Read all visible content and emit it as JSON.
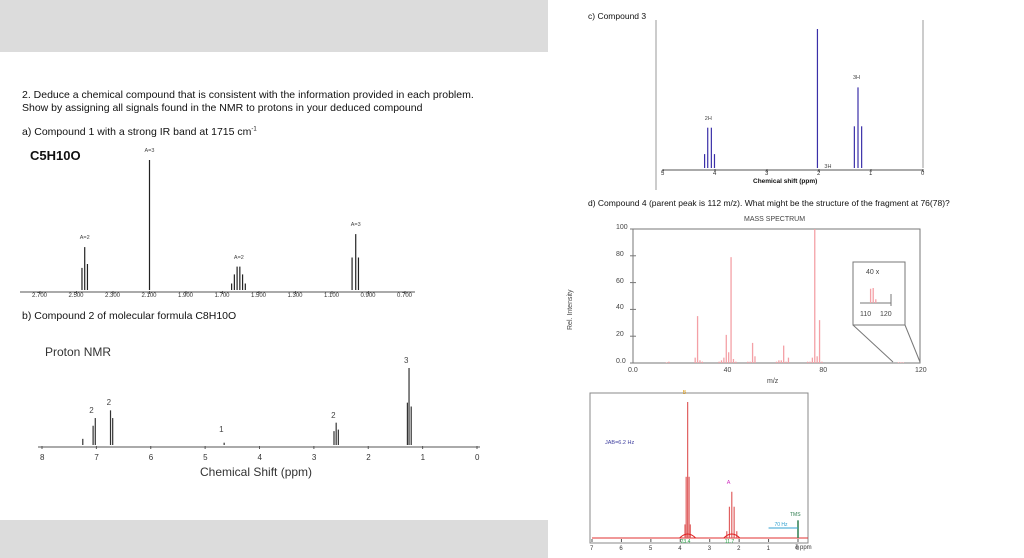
{
  "document": {
    "question": "2.  Deduce a chemical compound that is consistent with the information provided in each problem.",
    "question_line2": "Show by assigning all signals found in the NMR to protons in your deduced compound",
    "part_a": "a) Compound 1 with a strong IR band at 1715 cm",
    "part_a_sup": "-1",
    "part_a_formula": "C5H10O",
    "part_b": "b) Compound 2 of molecular formula C8H10O",
    "part_b_title": "Proton NMR",
    "part_c": "c)  Compound 3",
    "part_d": "d)  Compound 4 (parent peak is 112 m/z).  What might be the structure of the fragment at 76(78)?"
  },
  "chart_data": [
    {
      "id": "a",
      "type": "nmr",
      "xlim": [
        2.7,
        0.7
      ],
      "tick_labels": [
        "2.700",
        "2.500",
        "2.300",
        "2.100",
        "1.900",
        "1.700",
        "1.500",
        "1.300",
        "1.100",
        "0.900",
        "0.700"
      ],
      "peaks": [
        [
          2.47,
          0.17
        ],
        [
          2.455,
          0.33
        ],
        [
          2.44,
          0.2
        ],
        [
          2.1,
          1.0
        ],
        [
          1.65,
          0.05
        ],
        [
          1.635,
          0.12
        ],
        [
          1.62,
          0.18
        ],
        [
          1.605,
          0.18
        ],
        [
          1.59,
          0.12
        ],
        [
          1.575,
          0.05
        ],
        [
          0.99,
          0.25
        ],
        [
          0.97,
          0.43
        ],
        [
          0.955,
          0.25
        ]
      ],
      "annotations": [
        {
          "ppm": 2.455,
          "text": "A=2"
        },
        {
          "ppm": 2.1,
          "text": "A=3"
        },
        {
          "ppm": 1.61,
          "text": "A=2"
        },
        {
          "ppm": 0.97,
          "text": "A=3"
        }
      ],
      "color": "#222222"
    },
    {
      "id": "b",
      "type": "nmr",
      "xlim": [
        8,
        0
      ],
      "xlabel": "Chemical Shift (ppm)",
      "tick_labels": [
        "8",
        "7",
        "6",
        "5",
        "4",
        "3",
        "2",
        "1",
        "0"
      ],
      "peaks": [
        [
          7.25,
          0.08
        ],
        [
          7.06,
          0.25
        ],
        [
          7.02,
          0.35
        ],
        [
          6.74,
          0.45
        ],
        [
          6.7,
          0.35
        ],
        [
          4.65,
          0.03
        ],
        [
          2.63,
          0.18
        ],
        [
          2.59,
          0.29
        ],
        [
          2.55,
          0.2
        ],
        [
          1.28,
          0.55
        ],
        [
          1.25,
          1.0
        ],
        [
          1.21,
          0.5
        ]
      ],
      "annotations": [
        {
          "ppm": 7.04,
          "text": "2"
        },
        {
          "ppm": 6.72,
          "text": "2"
        },
        {
          "ppm": 4.65,
          "text": "1"
        },
        {
          "ppm": 2.59,
          "text": "2"
        },
        {
          "ppm": 1.25,
          "text": "3"
        }
      ],
      "color": "#333333"
    },
    {
      "id": "c",
      "type": "nmr",
      "xlim": [
        5,
        0
      ],
      "xlabel": "Chemical shift  (ppm)",
      "tick_labels": [
        "5",
        "4",
        "3",
        "2",
        "1",
        "0"
      ],
      "peaks": [
        [
          4.2,
          0.1
        ],
        [
          4.14,
          0.29
        ],
        [
          4.07,
          0.29
        ],
        [
          4.01,
          0.1
        ],
        [
          2.03,
          1.0
        ],
        [
          1.32,
          0.3
        ],
        [
          1.25,
          0.58
        ],
        [
          1.18,
          0.3
        ]
      ],
      "annotations": [
        {
          "ppm": 4.1,
          "text": "2H"
        },
        {
          "ppm": 1.8,
          "text": "3H"
        },
        {
          "ppm": 1.25,
          "text": "3H"
        }
      ],
      "color": "#3a2fa8"
    },
    {
      "id": "d",
      "type": "bar",
      "title": "MASS SPECTRUM",
      "xlabel": "m/z",
      "ylabel": "Rel. Intensity",
      "xlim": [
        0,
        120
      ],
      "ylim": [
        0,
        100
      ],
      "x_ticks": [
        "0.0",
        "40",
        "80",
        "120"
      ],
      "y_ticks": [
        "0.0",
        "20",
        "40",
        "60",
        "80",
        "100"
      ],
      "x": [
        14,
        15,
        26,
        27,
        28,
        29,
        36,
        37,
        38,
        39,
        40,
        41,
        42,
        43,
        48,
        49,
        50,
        51,
        60,
        61,
        62,
        63,
        64,
        65,
        73,
        74,
        75,
        76,
        77,
        78,
        79,
        111,
        112,
        113
      ],
      "values": [
        0.5,
        1,
        4,
        35,
        2,
        1,
        1,
        2,
        4,
        21,
        8,
        79,
        3,
        1,
        1,
        1,
        15,
        5,
        1,
        2,
        2,
        13,
        1,
        4,
        1,
        1,
        4,
        100,
        5,
        32,
        1,
        0.5,
        0.5,
        0.5
      ],
      "inset": {
        "label": "40 x",
        "x_ticks": [
          "110",
          "120"
        ],
        "x": [
          111,
          112,
          113
        ],
        "values": [
          0.57,
          0.6,
          0.15
        ]
      },
      "color": "#f4a0a6"
    },
    {
      "id": "e",
      "type": "nmr",
      "xlim": [
        7,
        0
      ],
      "xlabel": "δ ppm",
      "tick_labels": [
        "7",
        "6",
        "5",
        "4",
        "3",
        "2",
        "1",
        "0"
      ],
      "peaks": [
        [
          3.84,
          0.1
        ],
        [
          3.8,
          0.45
        ],
        [
          3.75,
          1.0
        ],
        [
          3.7,
          0.45
        ],
        [
          3.66,
          0.1
        ],
        [
          2.42,
          0.05
        ],
        [
          2.33,
          0.23
        ],
        [
          2.25,
          0.34
        ],
        [
          2.17,
          0.23
        ],
        [
          2.08,
          0.05
        ]
      ],
      "tms": {
        "ppm": 0,
        "height": 0.13,
        "label": "TMS",
        "color": "#2e7d4f"
      },
      "annotations": [
        {
          "ppm": 3.75,
          "text": "B",
          "color": "#e0a020"
        },
        {
          "ppm": 2.25,
          "text": "A",
          "color": "#d030c0"
        }
      ],
      "integrals": [
        {
          "ppm": 3.75,
          "text": "23.4"
        },
        {
          "ppm": 2.25,
          "text": "11.7"
        }
      ],
      "coupling": "JAB=6.2 Hz",
      "scale_label": "70 Hz",
      "color": "#e06060"
    }
  ]
}
